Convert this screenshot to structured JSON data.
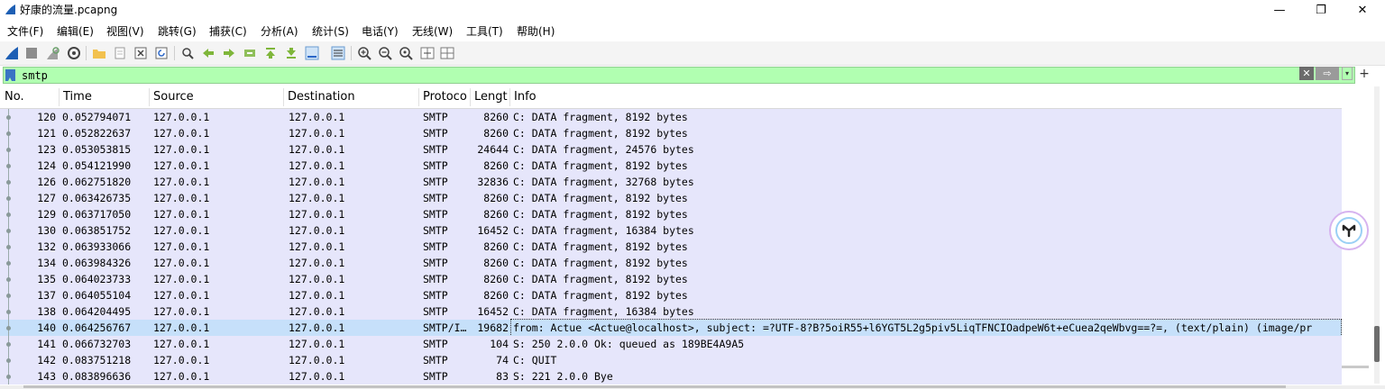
{
  "window": {
    "title": "好康的流量.pcapng",
    "controls": {
      "minimize": "—",
      "restore": "❐",
      "close": "✕"
    }
  },
  "menu": [
    "文件(F)",
    "编辑(E)",
    "视图(V)",
    "跳转(G)",
    "捕获(C)",
    "分析(A)",
    "统计(S)",
    "电话(Y)",
    "无线(W)",
    "工具(T)",
    "帮助(H)"
  ],
  "toolbar": {
    "icons": [
      "start-capture-icon",
      "stop-capture-icon",
      "restart-capture-icon",
      "capture-options-icon",
      "open-file-icon",
      "save-file-icon",
      "close-file-icon",
      "reload-file-icon",
      "find-packet-icon",
      "go-back-icon",
      "go-forward-icon",
      "go-to-packet-icon",
      "go-first-icon",
      "go-last-icon",
      "autoscroll-icon",
      "colorize-icon",
      "zoom-in-icon",
      "zoom-out-icon",
      "zoom-reset-icon",
      "resize-columns-icon",
      "layout-icon"
    ]
  },
  "filter": {
    "value": "smtp",
    "background": "#b1ffb1",
    "clear_label": "✕",
    "apply_label": "⇨",
    "dropdown_label": "▾",
    "add_label": "+"
  },
  "columns": {
    "no": "No.",
    "time": "Time",
    "source": "Source",
    "destination": "Destination",
    "protocol": "Protoco",
    "length": "Lengt",
    "info": "Info"
  },
  "packets": [
    {
      "no": "120",
      "time": "0.052794071",
      "source": "127.0.0.1",
      "destination": "127.0.0.1",
      "protocol": "SMTP",
      "length": "8260",
      "info": "C: DATA fragment, 8192 bytes"
    },
    {
      "no": "121",
      "time": "0.052822637",
      "source": "127.0.0.1",
      "destination": "127.0.0.1",
      "protocol": "SMTP",
      "length": "8260",
      "info": "C: DATA fragment, 8192 bytes"
    },
    {
      "no": "123",
      "time": "0.053053815",
      "source": "127.0.0.1",
      "destination": "127.0.0.1",
      "protocol": "SMTP",
      "length": "24644",
      "info": "C: DATA fragment, 24576 bytes"
    },
    {
      "no": "124",
      "time": "0.054121990",
      "source": "127.0.0.1",
      "destination": "127.0.0.1",
      "protocol": "SMTP",
      "length": "8260",
      "info": "C: DATA fragment, 8192 bytes"
    },
    {
      "no": "126",
      "time": "0.062751820",
      "source": "127.0.0.1",
      "destination": "127.0.0.1",
      "protocol": "SMTP",
      "length": "32836",
      "info": "C: DATA fragment, 32768 bytes"
    },
    {
      "no": "127",
      "time": "0.063426735",
      "source": "127.0.0.1",
      "destination": "127.0.0.1",
      "protocol": "SMTP",
      "length": "8260",
      "info": "C: DATA fragment, 8192 bytes"
    },
    {
      "no": "129",
      "time": "0.063717050",
      "source": "127.0.0.1",
      "destination": "127.0.0.1",
      "protocol": "SMTP",
      "length": "8260",
      "info": "C: DATA fragment, 8192 bytes"
    },
    {
      "no": "130",
      "time": "0.063851752",
      "source": "127.0.0.1",
      "destination": "127.0.0.1",
      "protocol": "SMTP",
      "length": "16452",
      "info": "C: DATA fragment, 16384 bytes"
    },
    {
      "no": "132",
      "time": "0.063933066",
      "source": "127.0.0.1",
      "destination": "127.0.0.1",
      "protocol": "SMTP",
      "length": "8260",
      "info": "C: DATA fragment, 8192 bytes"
    },
    {
      "no": "134",
      "time": "0.063984326",
      "source": "127.0.0.1",
      "destination": "127.0.0.1",
      "protocol": "SMTP",
      "length": "8260",
      "info": "C: DATA fragment, 8192 bytes"
    },
    {
      "no": "135",
      "time": "0.064023733",
      "source": "127.0.0.1",
      "destination": "127.0.0.1",
      "protocol": "SMTP",
      "length": "8260",
      "info": "C: DATA fragment, 8192 bytes"
    },
    {
      "no": "137",
      "time": "0.064055104",
      "source": "127.0.0.1",
      "destination": "127.0.0.1",
      "protocol": "SMTP",
      "length": "8260",
      "info": "C: DATA fragment, 8192 bytes"
    },
    {
      "no": "138",
      "time": "0.064204495",
      "source": "127.0.0.1",
      "destination": "127.0.0.1",
      "protocol": "SMTP",
      "length": "16452",
      "info": "C: DATA fragment, 16384 bytes"
    },
    {
      "no": "140",
      "time": "0.064256767",
      "source": "127.0.0.1",
      "destination": "127.0.0.1",
      "protocol": "SMTP/I…",
      "length": "19682",
      "info": "from: Actue <Actue@localhost>, subject: =?UTF-8?B?5oiR55+l6YGT5L2g5piv5LiqTFNCIOadpeW6t+eCuea2qeWbvg==?=,  (text/plain) (image/pr",
      "selected": true
    },
    {
      "no": "141",
      "time": "0.066732703",
      "source": "127.0.0.1",
      "destination": "127.0.0.1",
      "protocol": "SMTP",
      "length": "104",
      "info": "S: 250 2.0.0 Ok: queued as 189BE4A9A5"
    },
    {
      "no": "142",
      "time": "0.083751218",
      "source": "127.0.0.1",
      "destination": "127.0.0.1",
      "protocol": "SMTP",
      "length": "74",
      "info": "C: QUIT"
    },
    {
      "no": "143",
      "time": "0.083896636",
      "source": "127.0.0.1",
      "destination": "127.0.0.1",
      "protocol": "SMTP",
      "length": "83",
      "info": "S: 221 2.0.0 Bye"
    }
  ],
  "colors": {
    "row_bg": "#e6e6fb",
    "selected_bg": "#c6e0fa",
    "filter_ok": "#b1ffb1"
  }
}
